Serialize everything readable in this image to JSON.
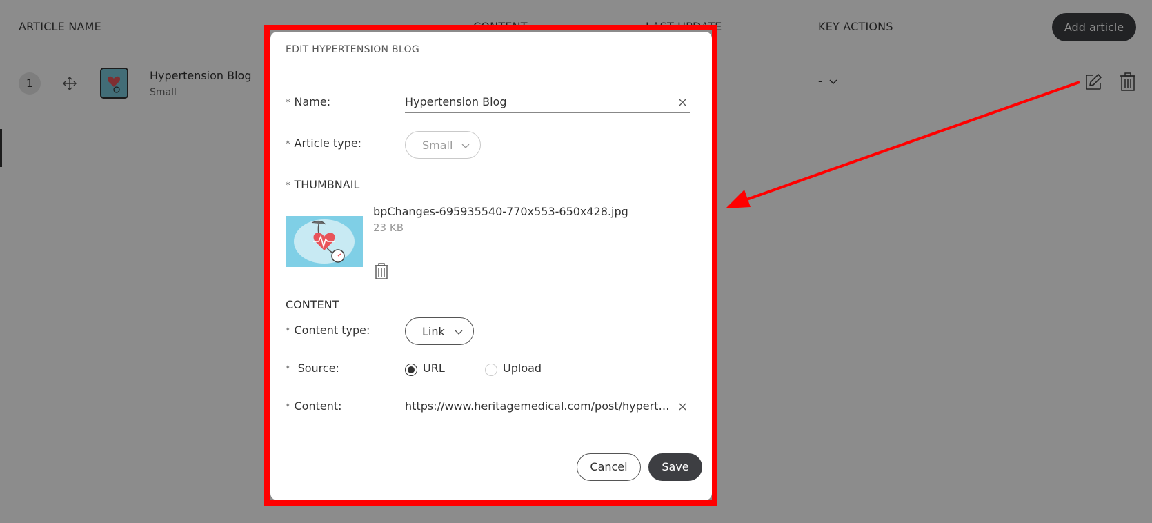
{
  "table": {
    "headers": {
      "article_name": "ARTICLE NAME",
      "content": "CONTENT",
      "last_update": "LAST UPDATE",
      "key_actions": "KEY ACTIONS"
    },
    "add_article_label": "Add article",
    "rows": [
      {
        "index": "1",
        "name": "Hypertension Blog",
        "type": "Small",
        "key_action": "-"
      }
    ]
  },
  "modal": {
    "title": "EDIT HYPERTENSION BLOG",
    "name_label": "Name:",
    "name_value": "Hypertension Blog",
    "article_type_label": "Article type:",
    "article_type_value": "Small",
    "thumbnail_label": "THUMBNAIL",
    "thumbnail_file_name": "bpChanges-695935540-770x553-650x428.jpg",
    "thumbnail_file_size": "23 KB",
    "content_section_title": "CONTENT",
    "content_type_label": "Content type:",
    "content_type_value": "Link",
    "source_label": "Source:",
    "source_options": [
      "URL",
      "Upload"
    ],
    "source_selected": "URL",
    "content_label": "Content:",
    "content_value": "https://www.heritagemedical.com/post/hypertension-blog",
    "cancel_label": "Cancel",
    "save_label": "Save"
  },
  "colors": {
    "highlight": "#ff0000",
    "primary_button": "#3d3e42",
    "thumbnail_bg": "#7fcfe6",
    "heart": "#e8545a"
  },
  "icons": [
    "move-icon",
    "edit-icon",
    "trash-icon",
    "chevron-down-icon",
    "close-icon",
    "arrow-annotation"
  ]
}
